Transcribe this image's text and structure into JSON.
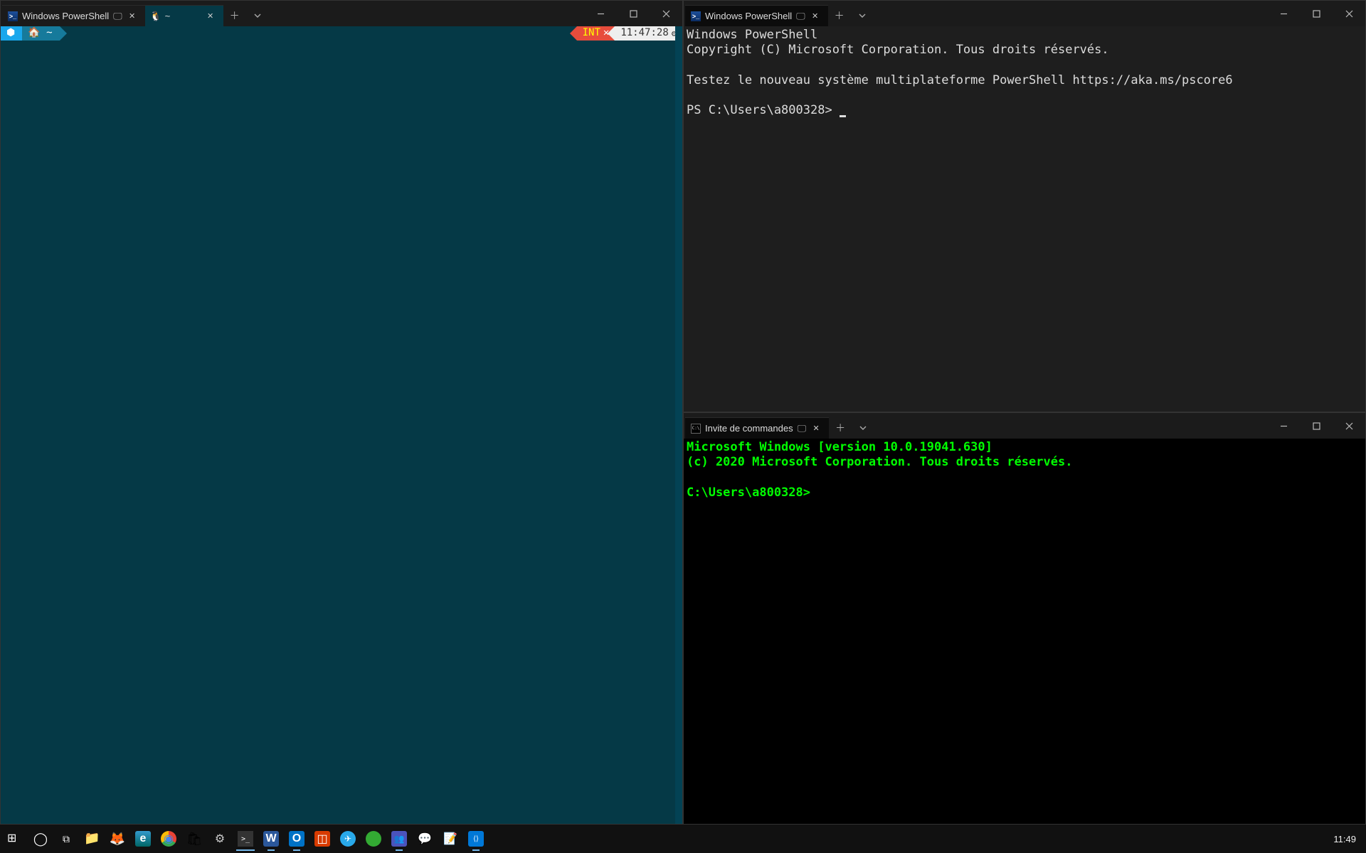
{
  "windows": {
    "top_left": {
      "tab": {
        "title": "Windows PowerShell",
        "icon": "powershell-icon",
        "sub": "🖵"
      },
      "body": {
        "line1": "Windows PowerShell",
        "line2": "Copyright (C) Microsoft Corporation. Tous droits réservés.",
        "line3": "",
        "line4": "Testez le nouveau système multiplateforme PowerShell https://aka.ms/pscore6",
        "line5": "",
        "prompt": "PS C:\\Users\\a800328> "
      }
    },
    "bottom_left": {
      "tab": {
        "title": "Invite de commandes",
        "icon": "cmd-icon",
        "sub": "🖵"
      },
      "body": {
        "line1": "Microsoft Windows [version 10.0.19041.630]",
        "line2": "(c) 2020 Microsoft Corporation. Tous droits réservés.",
        "line3": "",
        "prompt": "C:\\Users\\a800328>"
      }
    },
    "right": {
      "tabs": [
        {
          "title": "Windows PowerShell",
          "icon": "powershell-icon",
          "sub": "🖵",
          "active": false
        },
        {
          "title": "~",
          "icon": "linux-icon",
          "sub": "",
          "active": true
        }
      ],
      "status_left": {
        "icon": "⬢",
        "path": "🏠 ~"
      },
      "status_right": {
        "mode": "INT",
        "x": "✕",
        "time": "11:47:28",
        "gear": "⚙"
      }
    }
  },
  "taskbar": {
    "items": [
      {
        "name": "start",
        "label": "⊞"
      },
      {
        "name": "search",
        "label": "◯"
      },
      {
        "name": "taskview",
        "label": "⧉"
      },
      {
        "name": "explorer",
        "label": "📁"
      },
      {
        "name": "firefox",
        "label": "🦊"
      },
      {
        "name": "edge",
        "label": "e"
      },
      {
        "name": "chrome",
        "label": "◉"
      },
      {
        "name": "store",
        "label": "🛍"
      },
      {
        "name": "settings",
        "label": "⚙"
      },
      {
        "name": "terminal",
        "label": ">_"
      },
      {
        "name": "word",
        "label": "W"
      },
      {
        "name": "outlook",
        "label": "O"
      },
      {
        "name": "office",
        "label": "◫"
      },
      {
        "name": "telegram",
        "label": "✈"
      },
      {
        "name": "app-green",
        "label": "●"
      },
      {
        "name": "teams",
        "label": "👥"
      },
      {
        "name": "app-chat",
        "label": "💬"
      },
      {
        "name": "notepad",
        "label": "📝"
      },
      {
        "name": "vscode",
        "label": "⟨⟩"
      }
    ],
    "clock": "11:49"
  }
}
